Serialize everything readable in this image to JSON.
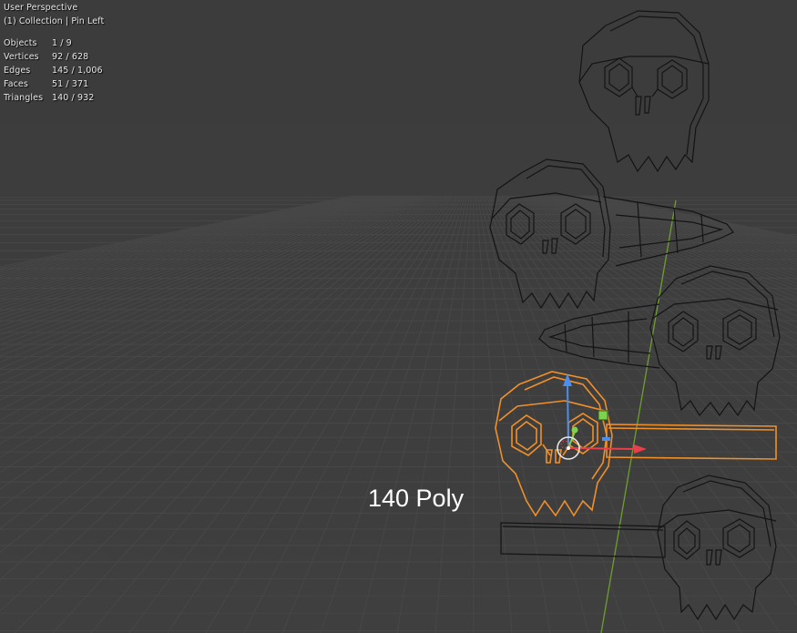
{
  "viewport": {
    "view_name": "User Perspective",
    "collection_line": "(1) Collection | Pin Left",
    "stats": [
      {
        "label": "Objects",
        "value": "1 / 9"
      },
      {
        "label": "Vertices",
        "value": "92 / 628"
      },
      {
        "label": "Edges",
        "value": "145 / 1,006"
      },
      {
        "label": "Faces",
        "value": "51 / 371"
      },
      {
        "label": "Triangles",
        "value": "140 / 932"
      }
    ],
    "caption": "140 Poly"
  },
  "colors": {
    "background": "#3d3d3d",
    "grid": "#464646",
    "wire": "#111111",
    "selected": "#f0902a",
    "gizmo_x": "#e8404a",
    "gizmo_y": "#7ed34c",
    "gizmo_z": "#4a8ef0",
    "y_axis_line": "#6e9e2e"
  },
  "icons": [
    "translate-gizmo-icon",
    "3d-cursor-icon"
  ]
}
